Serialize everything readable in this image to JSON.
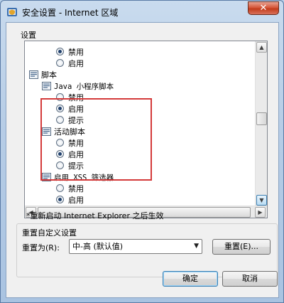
{
  "window": {
    "title": "安全设置 - Internet 区域",
    "close_glyph": "✕"
  },
  "settings": {
    "label": "设置",
    "tree": [
      {
        "kind": "radio",
        "label": "禁用",
        "checked": true
      },
      {
        "kind": "radio",
        "label": "启用",
        "checked": false
      },
      {
        "kind": "category",
        "label": "脚本"
      },
      {
        "kind": "subcategory",
        "label": "Java 小程序脚本"
      },
      {
        "kind": "radio",
        "label": "禁用",
        "checked": false
      },
      {
        "kind": "radio",
        "label": "启用",
        "checked": true
      },
      {
        "kind": "radio",
        "label": "提示",
        "checked": false
      },
      {
        "kind": "subcategory",
        "label": "活动脚本"
      },
      {
        "kind": "radio",
        "label": "禁用",
        "checked": false
      },
      {
        "kind": "radio",
        "label": "启用",
        "checked": true
      },
      {
        "kind": "radio",
        "label": "提示",
        "checked": false
      },
      {
        "kind": "subcategory",
        "label": "启用 XSS 筛选器"
      },
      {
        "kind": "radio",
        "label": "禁用",
        "checked": false
      },
      {
        "kind": "radio",
        "label": "启用",
        "checked": true
      }
    ]
  },
  "restart_note": "*重新启动 Internet Explorer 之后生效",
  "reset_group": {
    "label": "重置自定义设置",
    "reset_to_label": "重置为(R):",
    "dropdown_value": "中-高 (默认值)",
    "reset_button": "重置(E)..."
  },
  "buttons": {
    "ok": "确定",
    "cancel": "取消"
  },
  "colors": {
    "highlight": "#d43a3a",
    "title_bar": "#b9d1ea",
    "close_button": "#c23c1c"
  }
}
